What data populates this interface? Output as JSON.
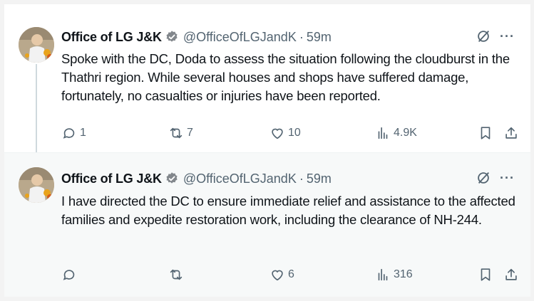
{
  "tweets": [
    {
      "author_name": "Office of LG J&K",
      "handle": "@OfficeOfLGJandK",
      "separator": "·",
      "time": "59m",
      "text": "Spoke with the DC, Doda to assess the situation following the cloudburst in the Thathri region. While several houses and shops have suffered damage, fortunately, no casualties or injuries have been reported.",
      "replies": "1",
      "reposts": "7",
      "likes": "10",
      "views": "4.9K"
    },
    {
      "author_name": "Office of LG J&K",
      "handle": "@OfficeOfLGJandK",
      "separator": "·",
      "time": "59m",
      "text": "I have directed the DC to ensure immediate relief and assistance to the affected families and expedite restoration work, including the clearance of NH-244.",
      "replies": "",
      "reposts": "",
      "likes": "6",
      "views": "316"
    }
  ],
  "more_icon_glyph": "···",
  "colors": {
    "accent": "#1d9bf0",
    "muted": "#536471",
    "text": "#0f1419"
  }
}
